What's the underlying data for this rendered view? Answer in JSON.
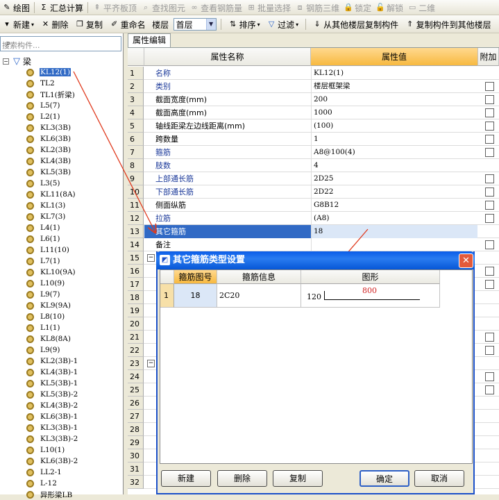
{
  "toolbar1": [
    {
      "label": "绘图",
      "icon": "pencil-icon",
      "glyph": "✎",
      "enabled": true
    },
    {
      "label": "汇总计算",
      "icon": "sigma-icon",
      "glyph": "Σ",
      "enabled": true
    },
    {
      "label": "平齐板顶",
      "icon": "align-icon",
      "glyph": "⇞",
      "enabled": false
    },
    {
      "label": "查找图元",
      "icon": "binoculars-icon",
      "glyph": "⌕",
      "enabled": false
    },
    {
      "label": "查看钢筋量",
      "icon": "rebar-view-icon",
      "glyph": "∞",
      "enabled": false
    },
    {
      "label": "批量选择",
      "icon": "batch-select-icon",
      "glyph": "⊞",
      "enabled": false
    },
    {
      "label": "钢筋三维",
      "icon": "rebar-3d-icon",
      "glyph": "⧈",
      "enabled": false
    },
    {
      "label": "锁定",
      "icon": "lock-icon",
      "glyph": "🔒",
      "enabled": false
    },
    {
      "label": "解锁",
      "icon": "unlock-icon",
      "glyph": "🔓",
      "enabled": false
    },
    {
      "label": "二维",
      "icon": "view-2d-icon",
      "glyph": "▭",
      "enabled": false
    }
  ],
  "toolbar2": {
    "new_label": "新建",
    "delete_label": "删除",
    "copy_label": "复制",
    "rename_label": "重命名",
    "floor_label": "楼层",
    "floor_value": "首层",
    "sort_label": "排序",
    "filter_label": "过滤",
    "copy_from_label": "从其他楼层复制构件",
    "copy_to_label": "复制构件到其他楼层"
  },
  "search": {
    "placeholder": "搜索构件..."
  },
  "tree": {
    "root": "梁",
    "items": [
      "KL12(1)",
      "TL2",
      "TL1(折梁)",
      "L5(7)",
      "L2(1)",
      "KL3(3B)",
      "KL6(3B)",
      "KL2(3B)",
      "KL4(3B)",
      "KL5(3B)",
      "L3(5)",
      "KL11(8A)",
      "KL1(3)",
      "KL7(3)",
      "L4(1)",
      "L6(1)",
      "L11(10)",
      "L7(1)",
      "KL10(9A)",
      "L10(9)",
      "L9(7)",
      "KL9(9A)",
      "L8(10)",
      "L1(1)",
      "KL8(8A)",
      "L9(9)",
      "KL2(3B)-1",
      "KL4(3B)-1",
      "KL5(3B)-1",
      "KL5(3B)-2",
      "KL4(3B)-2",
      "KL6(3B)-1",
      "KL3(3B)-1",
      "KL3(3B)-2",
      "L10(1)",
      "KL6(3B)-2",
      "LL2-1",
      "L-12",
      "异形梁LB"
    ],
    "selected_index": 0
  },
  "tab": "属性编辑",
  "grid": {
    "headers": {
      "name": "属性名称",
      "value": "属性值",
      "extra": "附加"
    },
    "rows": [
      {
        "n": "1",
        "name": "名称",
        "value": "KL12(1)",
        "blue": true,
        "check": false
      },
      {
        "n": "2",
        "name": "类别",
        "value": "楼层框架梁",
        "blue": true,
        "check": true
      },
      {
        "n": "3",
        "name": "截面宽度(mm)",
        "value": "200",
        "blue": false,
        "check": true
      },
      {
        "n": "4",
        "name": "截面高度(mm)",
        "value": "1000",
        "blue": false,
        "check": true
      },
      {
        "n": "5",
        "name": "轴线距梁左边线距离(mm)",
        "value": "(100)",
        "blue": false,
        "check": true
      },
      {
        "n": "6",
        "name": "跨数量",
        "value": "1",
        "blue": false,
        "check": true
      },
      {
        "n": "7",
        "name": "箍筋",
        "value": "A8@100(4)",
        "blue": true,
        "check": true
      },
      {
        "n": "8",
        "name": "肢数",
        "value": "4",
        "blue": true,
        "check": false
      },
      {
        "n": "9",
        "name": "上部通长筋",
        "value": "2D25",
        "blue": true,
        "check": true
      },
      {
        "n": "10",
        "name": "下部通长筋",
        "value": "2D22",
        "blue": true,
        "check": true
      },
      {
        "n": "11",
        "name": "侧面纵筋",
        "value": "G8B12",
        "blue": false,
        "check": true
      },
      {
        "n": "12",
        "name": "拉筋",
        "value": "(A8)",
        "blue": true,
        "check": true
      },
      {
        "n": "13",
        "name": "其它箍筋",
        "value": "18",
        "blue": false,
        "check": false,
        "selected": true
      },
      {
        "n": "14",
        "name": "备注",
        "value": "",
        "blue": false,
        "check": true
      },
      {
        "n": "15",
        "name": "",
        "value": "",
        "check": false,
        "group": true
      },
      {
        "n": "16",
        "name": "",
        "value": "",
        "check": true
      },
      {
        "n": "17",
        "name": "",
        "value": "",
        "check": true
      },
      {
        "n": "18",
        "name": "",
        "value": "",
        "check": false
      },
      {
        "n": "19",
        "name": "",
        "value": "",
        "check": false
      },
      {
        "n": "20",
        "name": "",
        "value": "",
        "check": false
      },
      {
        "n": "21",
        "name": "",
        "value": "",
        "check": true
      },
      {
        "n": "22",
        "name": "",
        "value": "",
        "check": true
      },
      {
        "n": "23",
        "name": "",
        "value": "",
        "check": false,
        "group": true
      },
      {
        "n": "24",
        "name": "",
        "value": "",
        "check": true
      },
      {
        "n": "25",
        "name": "",
        "value": "",
        "check": true
      },
      {
        "n": "26",
        "name": "",
        "value": "",
        "check": false
      },
      {
        "n": "27",
        "name": "",
        "value": "",
        "check": false
      },
      {
        "n": "28",
        "name": "",
        "value": "",
        "check": false
      },
      {
        "n": "29",
        "name": "",
        "value": "",
        "check": false
      },
      {
        "n": "30",
        "name": "",
        "value": "",
        "check": false
      },
      {
        "n": "31",
        "name": "",
        "value": "",
        "check": false
      },
      {
        "n": "32",
        "name": "",
        "value": "",
        "check": false
      }
    ]
  },
  "dialog": {
    "title": "其它箍筋类型设置",
    "headers": {
      "shape_no": "箍筋图号",
      "info": "箍筋信息",
      "shape": "图形"
    },
    "row": {
      "n": "1",
      "shape_no": "18",
      "info": "2C20",
      "left_len": "120",
      "length": "800"
    },
    "buttons": {
      "new": "新建",
      "delete": "删除",
      "copy": "复制",
      "ok": "确定",
      "cancel": "取消"
    }
  },
  "colors": {
    "selection": "#316ac5",
    "header_value": "#f7b940",
    "dialog_title": "#0a5ce8",
    "arrow": "#e03a1e",
    "label_blue": "#1c3a9a"
  }
}
